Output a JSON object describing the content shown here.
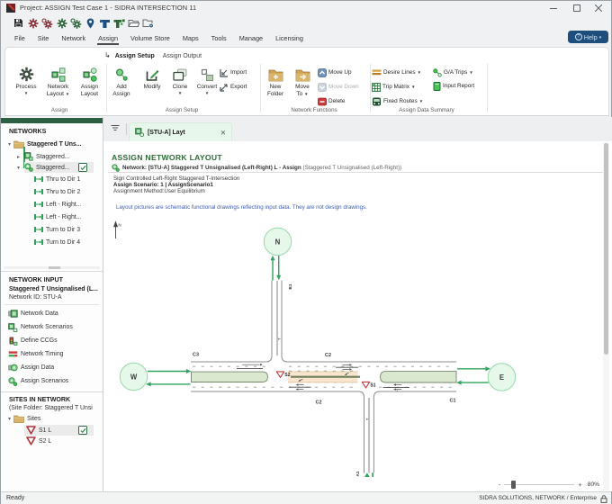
{
  "window": {
    "title": "Project: ASSIGN Test Case 1  -  SIDRA INTERSECTION 11",
    "controls": {
      "minimize": "minimize",
      "maximize": "maximize",
      "close": "close"
    }
  },
  "qat": {
    "icons": [
      "save-icon",
      "process-site-gear-icon",
      "process-site-gear-plus-icon",
      "process-network-gear-icon",
      "process-network-gear-plus-icon",
      "site-pin-icon",
      "intersection-blue-icon",
      "network-green-icon",
      "open-folder-icon",
      "open-project-folder-icon"
    ]
  },
  "menubar": {
    "items": [
      {
        "label": "File"
      },
      {
        "label": "Site"
      },
      {
        "label": "Network"
      },
      {
        "label": "Assign",
        "active": true
      },
      {
        "label": "Volume Store"
      },
      {
        "label": "Maps"
      },
      {
        "label": "Tools"
      },
      {
        "label": "Manage"
      },
      {
        "label": "Licensing"
      }
    ],
    "help_label": "Help"
  },
  "subtabs": {
    "items": [
      {
        "label": "Assign Setup",
        "active": true
      },
      {
        "label": "Assign Output"
      }
    ]
  },
  "ribbon": {
    "groups": [
      {
        "label": "Assign",
        "buttons": [
          {
            "line1": "Process",
            "line2": "",
            "dropdown": true,
            "icon": "process-gear-icon"
          },
          {
            "line1": "Network",
            "line2": "Layout",
            "dropdown": true,
            "icon": "network-layout-icon"
          },
          {
            "line1": "Assign",
            "line2": "Layout",
            "dropdown": false,
            "icon": "assign-layout-icon"
          }
        ]
      },
      {
        "label": "Assign Setup",
        "buttons": [
          {
            "line1": "Add",
            "line2": "Assign",
            "dropdown": false,
            "icon": "add-assign-icon"
          },
          {
            "line1": "Modify",
            "line2": "",
            "dropdown": false,
            "icon": "modify-icon"
          },
          {
            "line1": "Clone",
            "line2": "",
            "dropdown": true,
            "icon": "clone-icon"
          },
          {
            "line1": "Convert",
            "line2": "",
            "dropdown": true,
            "icon": "convert-icon"
          }
        ],
        "small_buttons": [
          {
            "label": "Import",
            "icon": "import-icon"
          },
          {
            "label": "Export",
            "icon": "export-icon"
          }
        ]
      },
      {
        "label": "Network Functions",
        "buttons": [
          {
            "line1": "New",
            "line2": "Folder",
            "dropdown": false,
            "icon": "new-folder-icon"
          },
          {
            "line1": "Move",
            "line2": "To",
            "dropdown": true,
            "icon": "move-to-folder-icon"
          }
        ],
        "small_buttons": [
          {
            "label": "Move Up",
            "icon": "move-up-icon"
          },
          {
            "label": "Move Down",
            "icon": "move-down-icon",
            "disabled": true
          },
          {
            "label": "Delete",
            "icon": "delete-icon"
          }
        ]
      },
      {
        "label": "Assign Data Summary",
        "small_buttons": [
          {
            "label": "Desire Lines",
            "icon": "desire-lines-icon",
            "dropdown": true
          },
          {
            "label": "Trip Matrix",
            "icon": "trip-matrix-icon",
            "dropdown": true
          },
          {
            "label": "Fixed Routes",
            "icon": "fixed-routes-icon",
            "dropdown": true
          },
          {
            "label": "G/A Trips",
            "icon": "ga-trips-icon",
            "dropdown": true
          },
          {
            "label": "Input Report",
            "icon": "input-report-icon",
            "dropdown": false
          }
        ]
      }
    ]
  },
  "sidebar": {
    "networks": {
      "header": "NETWORKS",
      "tree": [
        {
          "label": "Staggered T Uns...",
          "icon": "folder-icon",
          "expanded": true,
          "bold": true
        },
        {
          "label": "Staggered...",
          "icon": "network-node-icon",
          "collapsed": true
        },
        {
          "label": "Staggered...",
          "icon": "assign-node-icon",
          "expanded": true,
          "selected": true,
          "checked": true
        },
        {
          "label": "Thru to Dir 1",
          "icon": "route-icon"
        },
        {
          "label": "Thru to Dir 2",
          "icon": "route-icon"
        },
        {
          "label": "Left - Right...",
          "icon": "route-icon"
        },
        {
          "label": "Left - Right...",
          "icon": "route-icon"
        },
        {
          "label": "Turn to Dir 3",
          "icon": "route-icon"
        },
        {
          "label": "Turn to Dir 4",
          "icon": "route-icon"
        }
      ]
    },
    "network_input": {
      "header": "NETWORK INPUT",
      "network_name": "Staggered T Unsignalised (L...",
      "network_id": "Network ID:  STU-A",
      "items": [
        {
          "label": "Network Data",
          "icon": "network-data-icon"
        },
        {
          "label": "Network Scenarios",
          "icon": "network-scenarios-icon"
        },
        {
          "label": "Define CCGs",
          "icon": "define-ccgs-icon"
        },
        {
          "label": "Network Timing",
          "icon": "network-timing-icon"
        },
        {
          "label": "Assign Data",
          "icon": "assign-data-icon"
        },
        {
          "label": "Assign Scenarios",
          "icon": "assign-scenarios-icon"
        }
      ]
    },
    "sites_in_network": {
      "header": "SITES IN NETWORK",
      "subtitle": "(Site Folder: Staggered T Unsi",
      "tree": [
        {
          "label": "Sites",
          "icon": "folder-icon",
          "expanded": true
        },
        {
          "label": "S1 L",
          "icon": "giveway-icon",
          "selected": true,
          "checked": true
        },
        {
          "label": "S2 L",
          "icon": "giveway-icon"
        }
      ]
    }
  },
  "main": {
    "tab": {
      "title": "[STU-A] Layt",
      "icon": "network-assign-icon",
      "close": "close"
    },
    "header": {
      "title": "ASSIGN NETWORK LAYOUT",
      "network_bold": "Network: [STU-A] Staggered T Unsignalised (Left-Right) L - Assign",
      "network_rest": " (Staggered T Unsignalised (Left-Right))",
      "line1": "Sign Controlled Left-Right Staggered T-Intersection",
      "line2": "Assign Scenario: 1 | AssignScenario1",
      "line3": "Assignment Method:User Equilibrium",
      "note": "Layout pictures are schematic functional drawings reflecting input data. They are not design drawings."
    },
    "drawing": {
      "north_label": "N",
      "nodes": [
        {
          "label": "N"
        },
        {
          "label": "W"
        },
        {
          "label": "E"
        }
      ],
      "approach_labels": {
        "c3": "C3",
        "c2_top": "C2",
        "c2_bottom": "C2",
        "c1": "C1",
        "b1": "B1",
        "a1": "A1"
      },
      "lane_markers": {
        "north": "T",
        "south": "T"
      },
      "signs": [
        {
          "label": "S2"
        },
        {
          "label": "S1"
        }
      ]
    },
    "zoom": {
      "minus": "-",
      "plus": "+",
      "value": "80%"
    }
  },
  "statusbar": {
    "ready": "Ready",
    "license": "SIDRA SOLUTIONS, NETWORK / Enterprise"
  },
  "colors": {
    "accent_green_bar": "#2a5f41",
    "help_button": "#1d4e7c",
    "doc_title_green": "#2e6b38",
    "note_blue": "#3d5cb8",
    "tab_green": "#e7f7eb",
    "sign_red": "#c43c3c",
    "arrow_green": "#2fa45e",
    "median_green": "#d9e8cf",
    "band_orange": "#f9e6cc"
  }
}
